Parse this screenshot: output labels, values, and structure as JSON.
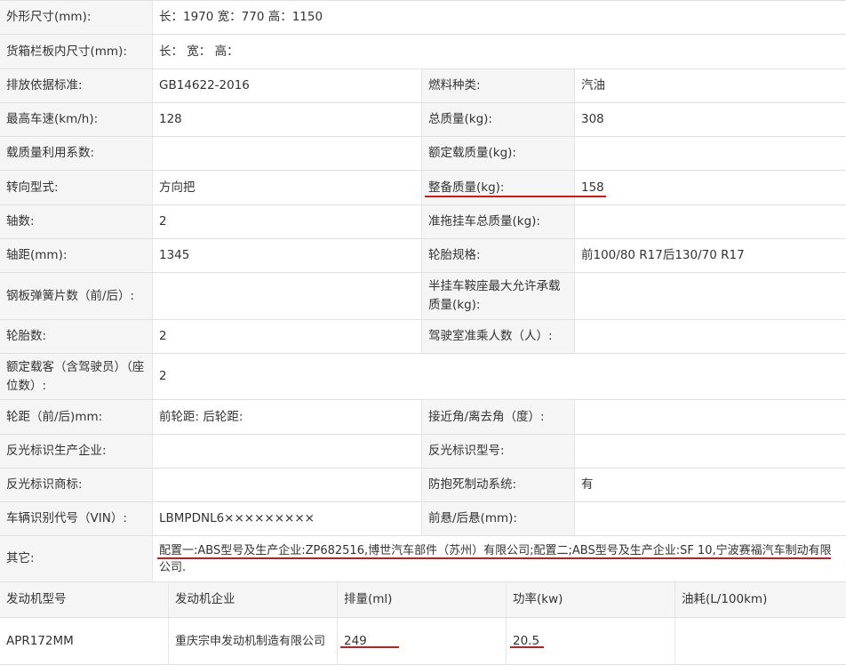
{
  "spec_rows": [
    {
      "l1": "外形尺寸(mm):",
      "v1": "长：1970 宽：770 高：1150"
    },
    {
      "l1": "货箱栏板内尺寸(mm):",
      "v1": "长：  宽：  高："
    },
    {
      "l1": "排放依据标准:",
      "v1": "GB14622-2016",
      "l2": "燃料种类:",
      "v2": "汽油"
    },
    {
      "l1": "最高车速(km/h):",
      "v1": "128",
      "l2": "总质量(kg):",
      "v2": "308"
    },
    {
      "l1": "载质量利用系数:",
      "v1": "",
      "l2": "额定载质量(kg):",
      "v2": ""
    },
    {
      "l1": "转向型式:",
      "v1": "方向把",
      "l2": "整备质量(kg):",
      "v2": "158"
    },
    {
      "l1": "轴数:",
      "v1": "2",
      "l2": "准拖挂车总质量(kg):",
      "v2": ""
    },
    {
      "l1": "轴距(mm):",
      "v1": "1345",
      "l2": "轮胎规格:",
      "v2": "前100/80 R17后130/70 R17"
    },
    {
      "l1": "钢板弹簧片数（前/后）:",
      "v1": "",
      "l2": "半挂车鞍座最大允许承载质量(kg):",
      "v2": ""
    },
    {
      "l1": "轮胎数:",
      "v1": "2",
      "l2": "驾驶室准乘人数（人）:",
      "v2": ""
    },
    {
      "l1": "额定载客（含驾驶员）（座位数）:",
      "v1": "2"
    },
    {
      "l1": "轮距（前/后)mm:",
      "v1": "前轮距: 后轮距:",
      "l2": "接近角/离去角（度）:",
      "v2": ""
    },
    {
      "l1": "反光标识生产企业:",
      "v1": "",
      "l2": "反光标识型号:",
      "v2": ""
    },
    {
      "l1": "反光标识商标:",
      "v1": "",
      "l2": "防抱死制动系统:",
      "v2": "有"
    },
    {
      "l1": "车辆识别代号（VIN）:",
      "v1": "LBMPDNL6×××××××××",
      "l2": "前悬/后悬(mm):",
      "v2": ""
    },
    {
      "l1": "其它:",
      "v1": "配置一:ABS型号及生产企业:ZP682516,博世汽车部件（苏州）有限公司;配置二;ABS型号及生产企业:SF 10,宁波赛福汽车制动有限公司."
    }
  ],
  "engine_table": {
    "headers": [
      "发动机型号",
      "发动机企业",
      "排量(ml)",
      "功率(kw)",
      "油耗(L/100km)"
    ],
    "row": [
      "APR172MM",
      "重庆宗申发动机制造有限公司",
      "249",
      "20.5",
      ""
    ]
  },
  "accent_color": "#d01818"
}
